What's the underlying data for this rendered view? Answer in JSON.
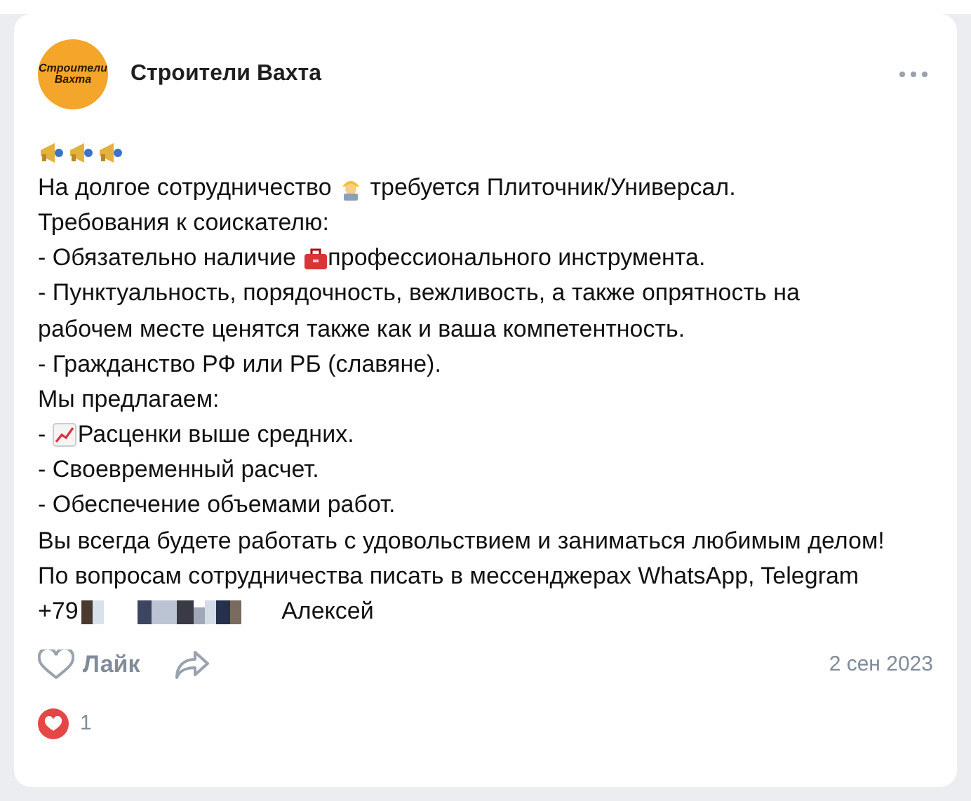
{
  "post": {
    "author": {
      "name": "Строители Вахта",
      "avatar_text": "Строители Вахта"
    },
    "lines": [
      [
        {
          "kind": "megaphone"
        },
        {
          "kind": "megaphone"
        },
        {
          "kind": "megaphone"
        }
      ],
      [
        {
          "kind": "text",
          "text": "На долгое сотрудничество "
        },
        {
          "kind": "worker"
        },
        {
          "kind": "text",
          "text": " требуется Плиточник/Универсал."
        }
      ],
      [
        {
          "kind": "text",
          "text": "Требования к соискателю:"
        }
      ],
      [
        {
          "kind": "text",
          "text": "- Обязательно наличие "
        },
        {
          "kind": "toolbox"
        },
        {
          "kind": "text",
          "text": "профессионального инструмента."
        }
      ],
      [
        {
          "kind": "text",
          "text": "- Пунктуальность, порядочность, вежливость, а также опрятность на"
        }
      ],
      [
        {
          "kind": "text",
          "text": "рабочем месте ценятся также как и ваша компетентность."
        }
      ],
      [
        {
          "kind": "text",
          "text": "- Гражданство РФ или РБ (славяне)."
        }
      ],
      [
        {
          "kind": "text",
          "text": "Мы предлагаем:"
        }
      ],
      [
        {
          "kind": "text",
          "text": "- "
        },
        {
          "kind": "chart"
        },
        {
          "kind": "text",
          "text": "Расценки выше средних."
        }
      ],
      [
        {
          "kind": "text",
          "text": "- Своевременный расчет."
        }
      ],
      [
        {
          "kind": "text",
          "text": "- Обеспечение объемами работ."
        }
      ],
      [
        {
          "kind": "text",
          "text": "Вы всегда будете работать с удовольствием и заниматься любимым делом!"
        }
      ],
      [
        {
          "kind": "text",
          "text": "По вопросам сотрудничества писать в мессенджерах WhatsApp, Telegram"
        }
      ],
      [
        {
          "kind": "text",
          "text": "+79"
        },
        {
          "kind": "blur"
        },
        {
          "kind": "text",
          "text": " Алексей"
        }
      ]
    ],
    "like_label": "Лайк",
    "date": "2 сен 2023",
    "reactions_count": "1"
  }
}
